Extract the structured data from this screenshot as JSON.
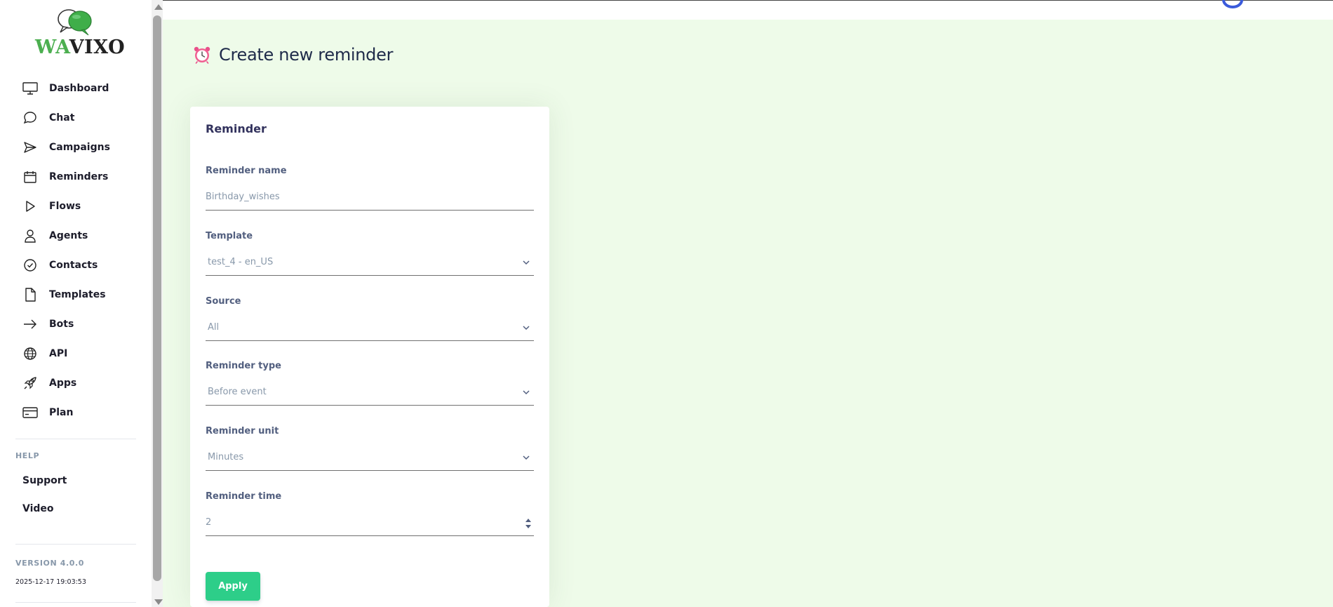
{
  "brand": {
    "logo_text_a": "WA",
    "logo_text_b": "VIXO",
    "colors": {
      "green": "#4caf50",
      "dark": "#222222"
    }
  },
  "sidebar": {
    "items": [
      {
        "label": "Dashboard",
        "icon": "monitor-icon"
      },
      {
        "label": "Chat",
        "icon": "chat-bubble-icon"
      },
      {
        "label": "Campaigns",
        "icon": "send-icon"
      },
      {
        "label": "Reminders",
        "icon": "calendar-icon"
      },
      {
        "label": "Flows",
        "icon": "play-icon"
      },
      {
        "label": "Agents",
        "icon": "user-icon"
      },
      {
        "label": "Contacts",
        "icon": "check-circle-icon"
      },
      {
        "label": "Templates",
        "icon": "document-icon"
      },
      {
        "label": "Bots",
        "icon": "arrow-right-icon"
      },
      {
        "label": "API",
        "icon": "globe-icon"
      },
      {
        "label": "Apps",
        "icon": "rocket-icon"
      },
      {
        "label": "Plan",
        "icon": "credit-card-icon"
      }
    ],
    "help_heading": "HELP",
    "help_links": [
      "Support",
      "Video"
    ],
    "version": "VERSION 4.0.0",
    "build_date": "2025-12-17 19:03:53"
  },
  "page": {
    "title": "Create new reminder",
    "title_icon": "alarm-clock-icon",
    "background": "#eefbe9"
  },
  "form": {
    "card_title": "Reminder",
    "reminder_name": {
      "label": "Reminder name",
      "placeholder": "Birthday_wishes"
    },
    "template": {
      "label": "Template",
      "value": "test_4 - en_US"
    },
    "source": {
      "label": "Source",
      "value": "All"
    },
    "reminder_type": {
      "label": "Reminder type",
      "value": "Before event"
    },
    "reminder_unit": {
      "label": "Reminder unit",
      "value": "Minutes"
    },
    "reminder_time": {
      "label": "Reminder time",
      "value": "2"
    },
    "apply_label": "Apply",
    "accent": "#2dce89"
  }
}
